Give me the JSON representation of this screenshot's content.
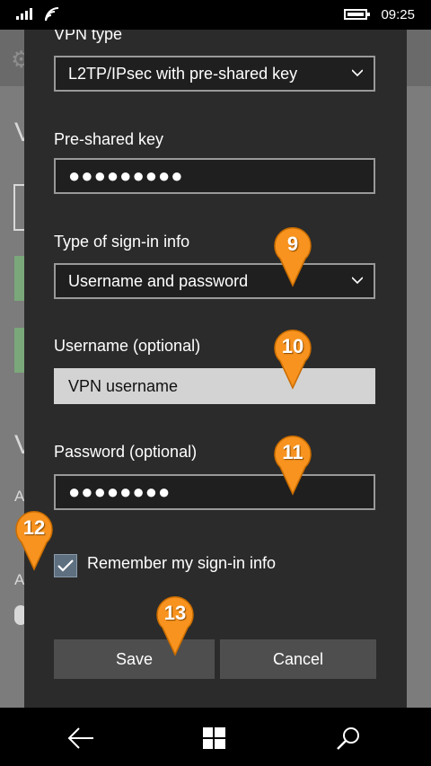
{
  "status_bar": {
    "time": "09:25",
    "icons": [
      "signal-icon",
      "wifi-icon",
      "battery-icon"
    ]
  },
  "background_page": {
    "heading_1": "V",
    "heading_2": "V",
    "label_a1": "A",
    "label_a2": "A"
  },
  "dialog": {
    "vpn_type_label": "VPN type",
    "vpn_type_value": "L2TP/IPsec with pre-shared key",
    "preshared_label": "Pre-shared key",
    "preshared_value": "●●●●●●●●●",
    "signin_type_label": "Type of sign-in info",
    "signin_type_value": "Username and password",
    "username_label": "Username (optional)",
    "username_value": "VPN username",
    "password_label": "Password (optional)",
    "password_value": "●●●●●●●●",
    "remember_label": "Remember my sign-in info",
    "remember_checked": true,
    "save_label": "Save",
    "cancel_label": "Cancel"
  },
  "markers": [
    "9",
    "10",
    "11",
    "12",
    "13"
  ],
  "colors": {
    "dialog_bg": "#2b2b2b",
    "marker_orange": "#f7931e",
    "checkbox_fill": "#5e6f80"
  },
  "navbar": {
    "buttons": [
      "back-icon",
      "windows-icon",
      "search-icon"
    ]
  }
}
